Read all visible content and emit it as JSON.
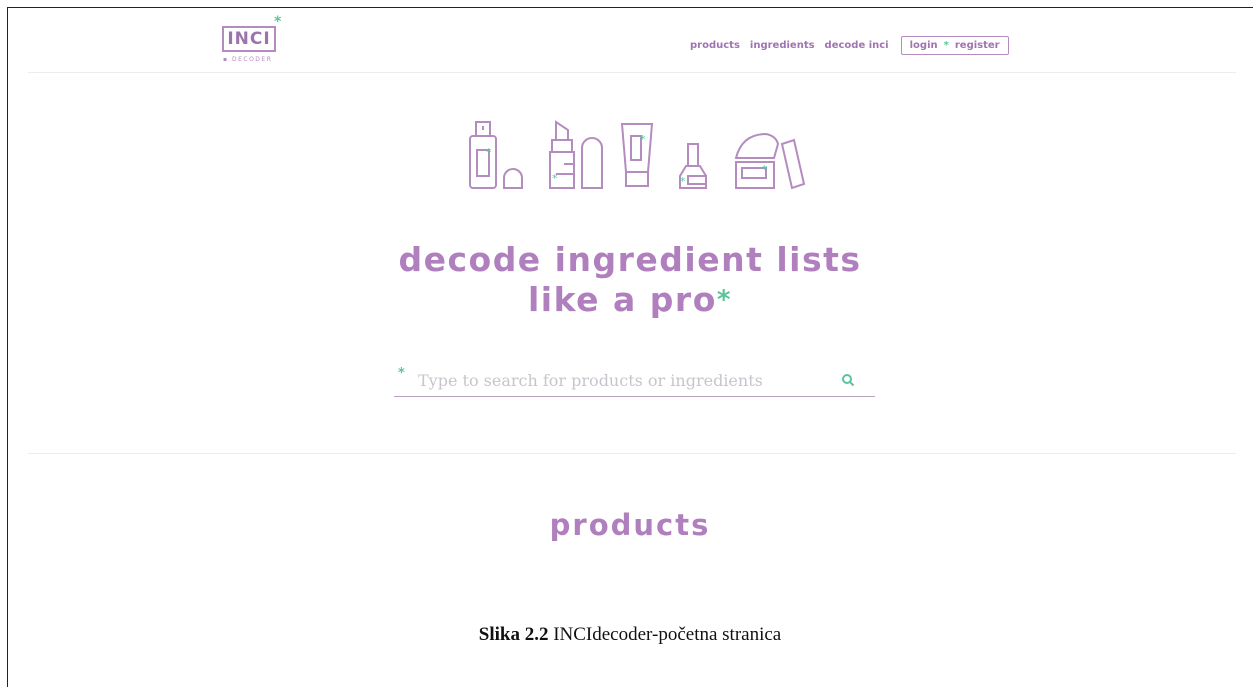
{
  "logo": {
    "main": "INCI",
    "sub": "DECODER",
    "star": "*"
  },
  "nav": {
    "products": "products",
    "ingredients": "ingredients",
    "decode": "decode inci",
    "login": "login",
    "separator": "*",
    "register": "register"
  },
  "hero": {
    "line1": "decode ingredient lists",
    "line2": "like a pro",
    "star": "*"
  },
  "search": {
    "placeholder": "Type to search for products or ingredients",
    "star": "*",
    "icon": "search-icon"
  },
  "section": {
    "title": "products"
  },
  "caption": {
    "label": "Slika 2.2",
    "text": " INCIdecoder-početna stranica"
  },
  "colors": {
    "brand_purple": "#b07fbd",
    "accent_green": "#5cc49b"
  }
}
